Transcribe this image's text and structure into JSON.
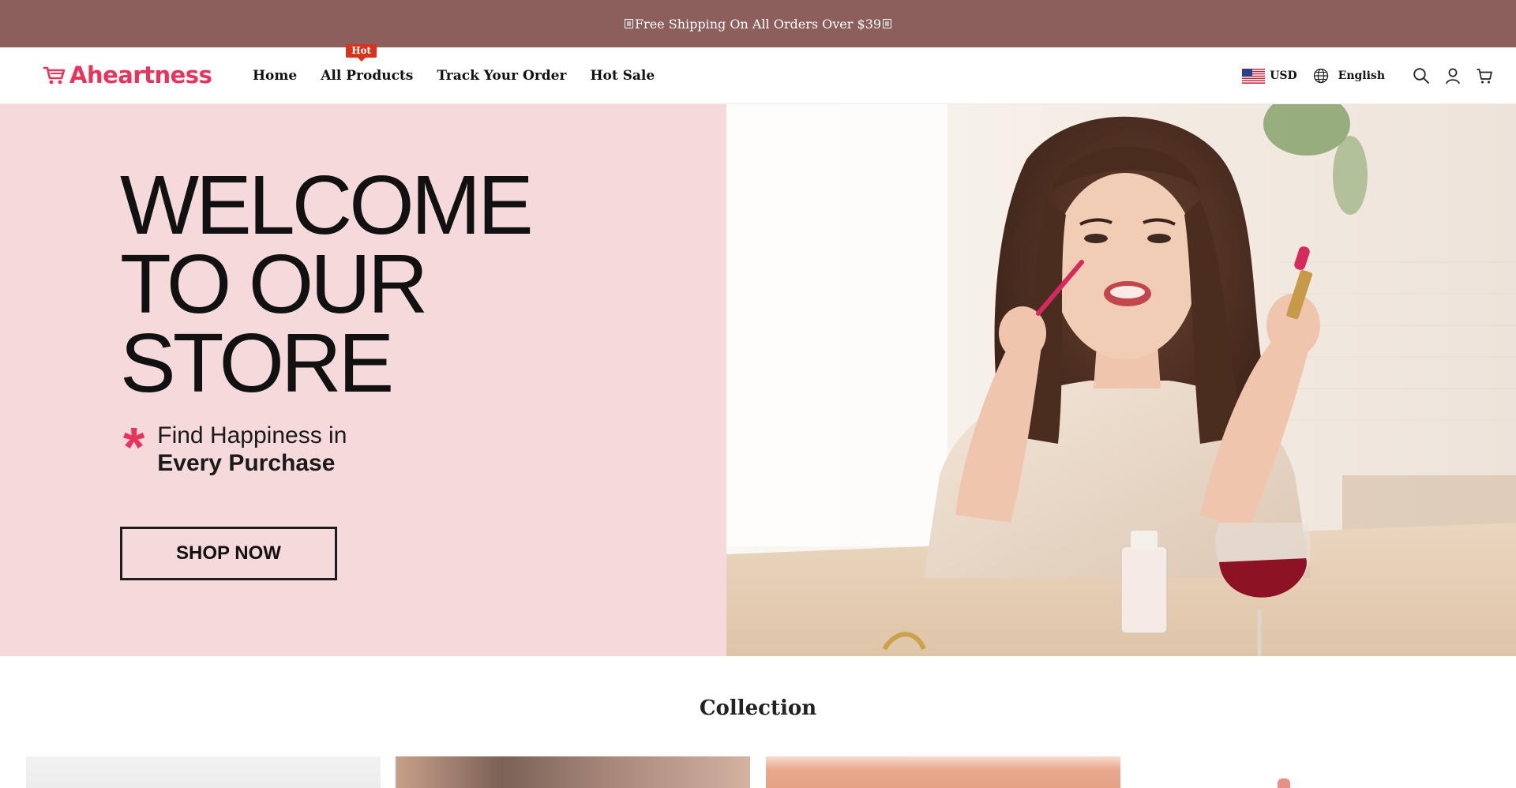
{
  "announcement": {
    "text": "Free Shipping On All Orders Over $39"
  },
  "header": {
    "logo_text": "Aheartness",
    "nav": [
      {
        "label": "Home"
      },
      {
        "label": "All Products",
        "badge": "Hot"
      },
      {
        "label": "Track Your Order"
      },
      {
        "label": "Hot Sale"
      }
    ],
    "currency": "USD",
    "language": "English",
    "icons": [
      "globe-icon",
      "search-icon",
      "account-icon",
      "cart-icon",
      "us-flag-icon",
      "cart-logo-icon"
    ]
  },
  "hero": {
    "title_lines": [
      "WELCOME",
      "TO OUR",
      "STORE"
    ],
    "subtitle_line1": "Find Happiness in",
    "subtitle_line2": "Every Purchase",
    "cta_label": "SHOP NOW",
    "asterisk": "*"
  },
  "collection": {
    "title": "Collection"
  },
  "colors": {
    "announcement_bg": "#8c5f5c",
    "brand": "#e8335a",
    "hero_bg": "#f5d9db",
    "hot_badge": "#d8331c"
  }
}
